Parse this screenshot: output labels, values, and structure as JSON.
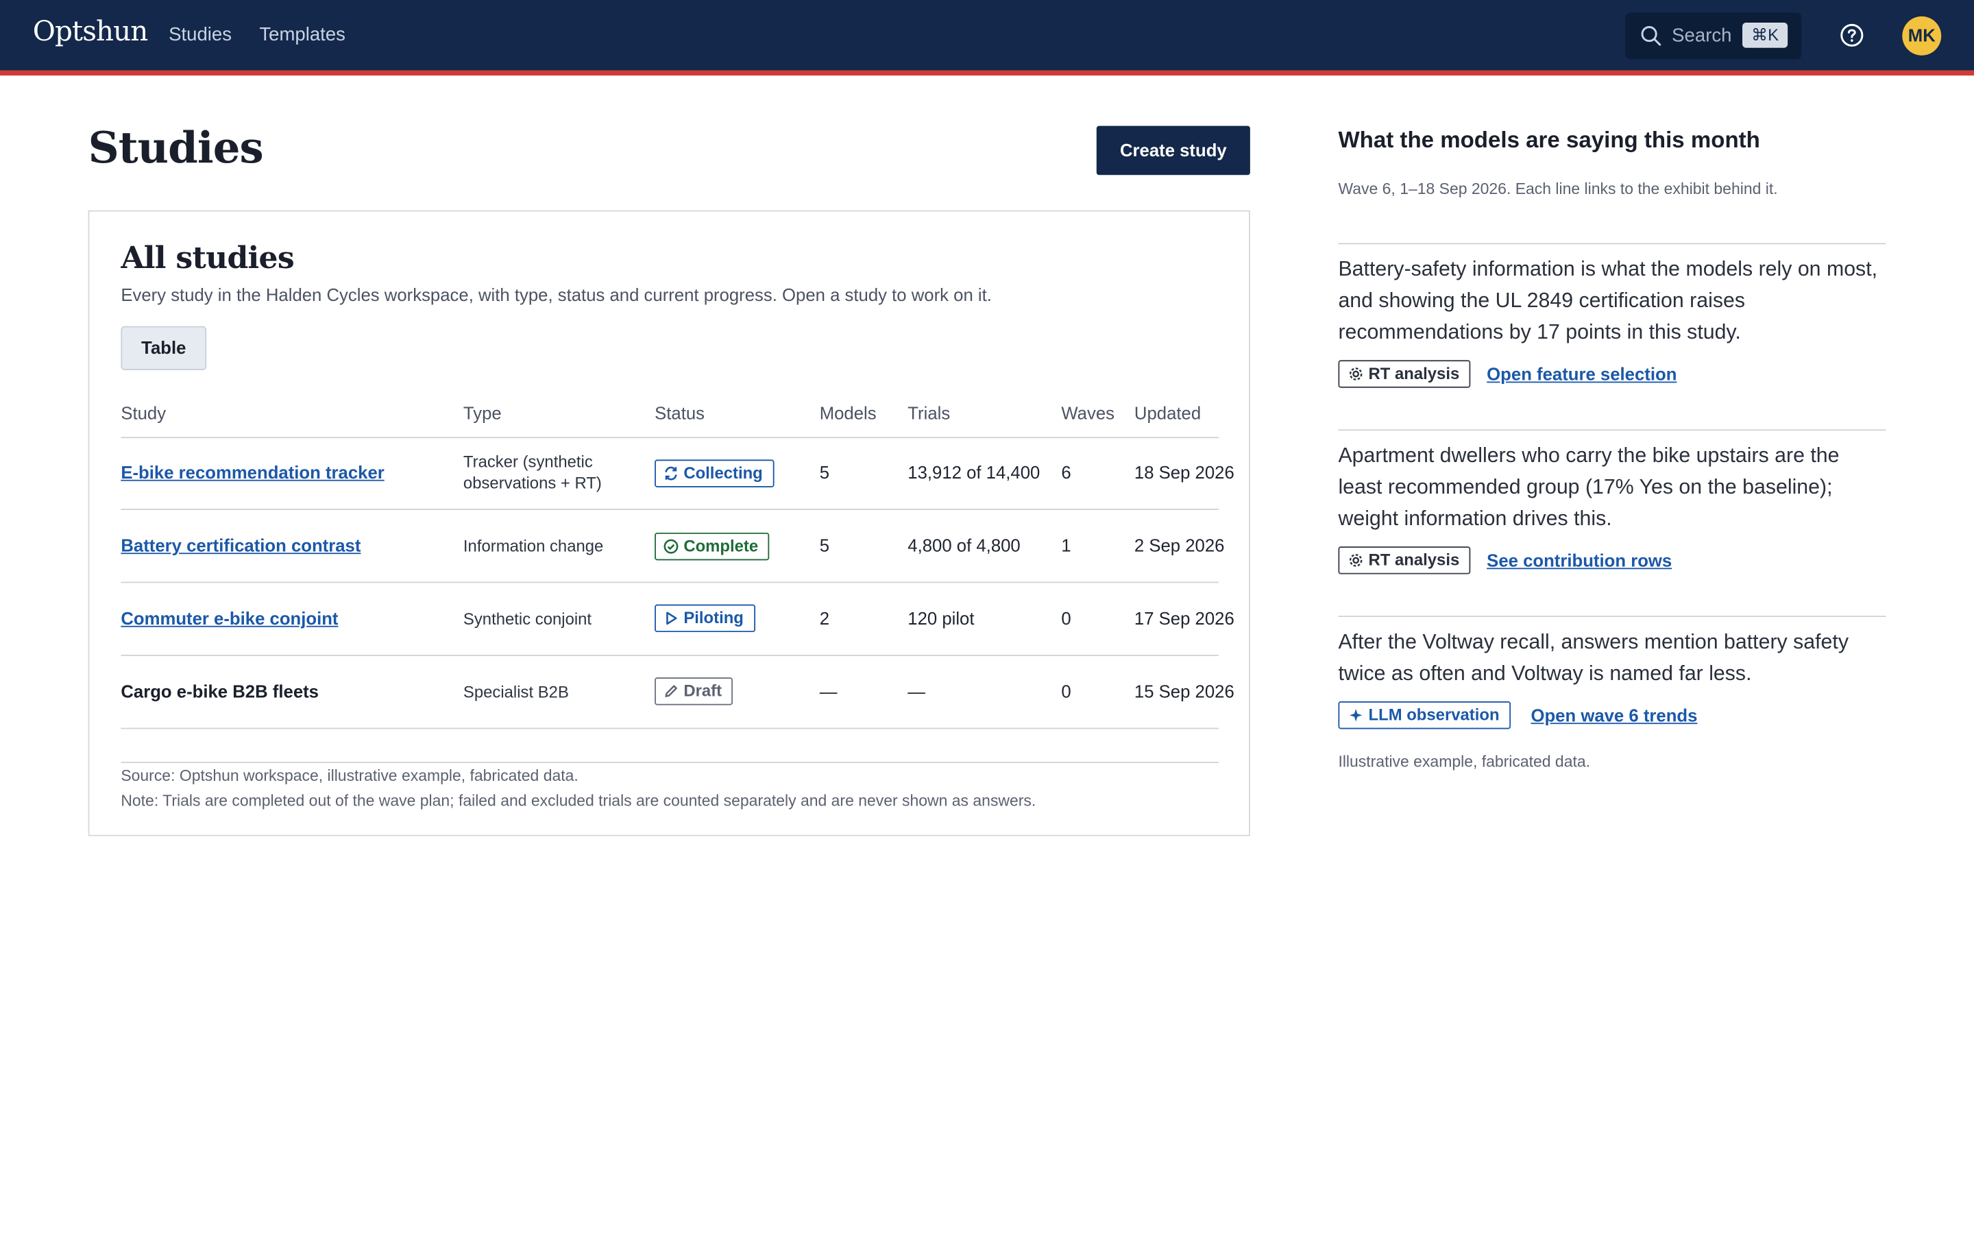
{
  "app": {
    "brand": "Optshun",
    "nav": [
      "Studies",
      "Templates"
    ],
    "search_placeholder": "Search",
    "search_shortcut": "⌘K",
    "user_initials": "MK"
  },
  "page": {
    "title": "Studies",
    "create_label": "Create study"
  },
  "card": {
    "title": "All studies",
    "description": "Every study in the Halden Cycles workspace, with type, status and current progress. Open a study to work on it.",
    "view_tab": "Table",
    "columns": [
      "Study",
      "Type",
      "Status",
      "Models",
      "Trials",
      "Waves",
      "Updated"
    ],
    "rows": [
      {
        "study": "E-bike recommendation tracker",
        "type": "Tracker (synthetic observations + RT)",
        "status": "Collecting",
        "models": "5",
        "trials": "13,912 of 14,400",
        "waves": "6",
        "updated": "18 Sep 2026"
      },
      {
        "study": "Battery certification contrast",
        "type": "Information change",
        "status": "Complete",
        "models": "5",
        "trials": "4,800 of 4,800",
        "waves": "1",
        "updated": "2 Sep 2026"
      },
      {
        "study": "Commuter e-bike conjoint",
        "type": "Synthetic conjoint",
        "status": "Piloting",
        "models": "2",
        "trials": "120 pilot",
        "waves": "0",
        "updated": "17 Sep 2026"
      },
      {
        "study": "Cargo e-bike B2B fleets",
        "type": "Specialist B2B",
        "status": "Draft",
        "models": "—",
        "trials": "—",
        "waves": "0",
        "updated": "15 Sep 2026"
      }
    ],
    "source": "Source: Optshun workspace, illustrative example, fabricated data.",
    "note": "Note: Trials are completed out of the wave plan; failed and excluded trials are counted separately and are never shown as answers."
  },
  "side": {
    "title": "What the models are saying this month",
    "subtitle": "Wave 6, 1–18 Sep 2026. Each line links to the exhibit behind it.",
    "findings": [
      {
        "text": "Battery-safety information is what the models rely on most, and showing the UL 2849 certification raises recommendations by 17 points in this study.",
        "tag": "RT analysis",
        "link": "Open feature selection"
      },
      {
        "text": "Apartment dwellers who carry the bike upstairs are the least recommended group (17% Yes on the baseline); weight information drives this.",
        "tag": "RT analysis",
        "link": "See contribution rows"
      },
      {
        "text": "After the Voltway recall, answers mention battery safety twice as often and Voltway is named far less.",
        "tag": "LLM observation",
        "link": "Open wave 6 trends"
      }
    ],
    "footnote": "Illustrative example, fabricated data."
  },
  "colors": {
    "header": "#13284a",
    "accent_rule": "#d33a33",
    "link": "#1b58a8",
    "complete": "#1f6b3a",
    "avatar": "#f2c23f"
  }
}
